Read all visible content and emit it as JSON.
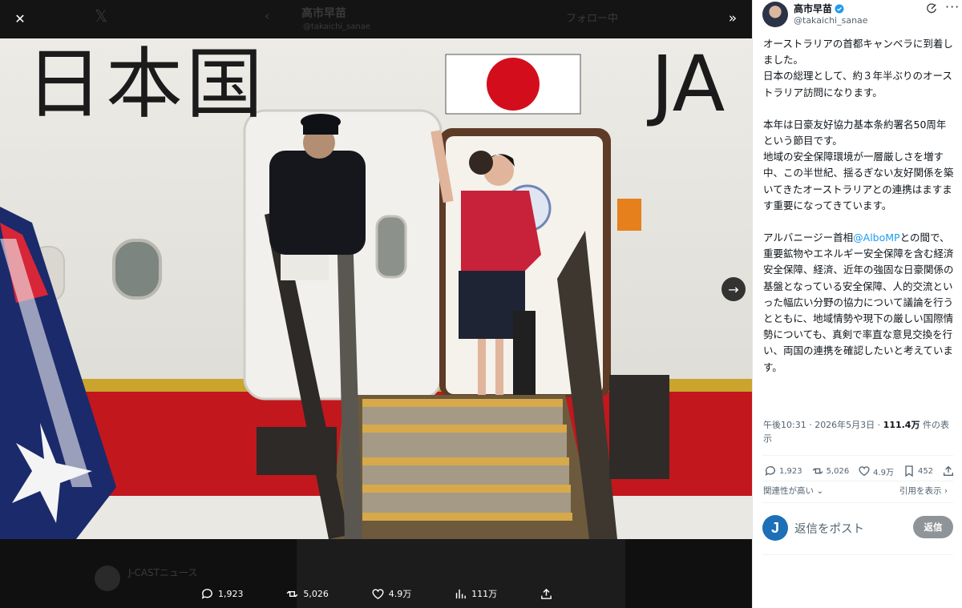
{
  "background": {
    "header_name": "高市早苗",
    "header_handle": "@takaichi_sanae",
    "header_follow": "フォロー中",
    "news_name": "J-CASTニュース",
    "x_logo": "𝕏"
  },
  "photo": {
    "sign_text": "日本国",
    "sign_text_right": "JA"
  },
  "icons": {
    "close": "✕",
    "expand": "»",
    "next": "→"
  },
  "media_actions": {
    "replies": "1,923",
    "reposts": "5,026",
    "likes": "4.9万",
    "views": "111万"
  },
  "post": {
    "author_name": "高市早苗",
    "author_handle": "@takaichi_sanae",
    "verified_color": "#1d9bf0",
    "paragraphs": [
      "オーストラリアの首都キャンベラに到着しました。",
      "日本の総理として、約３年半ぶりのオーストラリア訪問になります。",
      "",
      "本年は日豪友好協力基本条約署名50周年という節目です。",
      "地域の安全保障環境が一層厳しさを増す中、この半世紀、揺るぎない友好関係を築いてきたオーストラリアとの連携はますます重要になってきています。",
      "",
      "アルバニージー首相",
      "で、重要鉱物やエネルギー安全保障を含む経済安全保障、経済、近年の強固な日豪関係の基盤となっている安全保障、人的交流といった幅広い分野の協力について議論を行うとともに、地域情勢や現下の厳しい国際情勢についても、真剣で率直な意見交換を行い、両国の連携を確認したいと考えています。"
    ],
    "mention": "@AlboMP",
    "mention_suffix": "との間",
    "meta_time": "午後10:31 · 2026年5月3日 · ",
    "meta_views": "111.4万",
    "meta_views_suffix": " 件の表示",
    "replies": "1,923",
    "reposts": "5,026",
    "likes": "4.9万",
    "bookmarks": "452",
    "sort_label": "関連性が高い",
    "quotes_label": "引用を表示",
    "reply_avatar_letter": "J",
    "reply_placeholder": "返信をポスト",
    "reply_button": "返信"
  }
}
